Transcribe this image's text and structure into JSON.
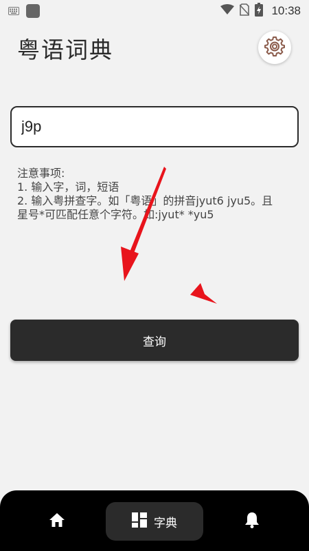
{
  "status_bar": {
    "time": "10:38",
    "icons": [
      "keyboard-icon",
      "app-icon",
      "wifi-icon",
      "no-sim-icon",
      "battery-charging-icon"
    ]
  },
  "header": {
    "title": "粤语词典",
    "settings_icon": "gear-icon"
  },
  "search": {
    "value": "j9p"
  },
  "notes": {
    "heading": "注意事项:",
    "line1": "1. 输入字，词，短语",
    "line2": "2. 输入粤拼查字。如「粤语」的拼音jyut6  jyu5。且",
    "line3": "星号*可匹配任意个字符。如:jyut*  *yu5"
  },
  "query_button": {
    "label": "查询"
  },
  "annotation": {
    "color": "#e8141c"
  },
  "bottom_nav": {
    "items": [
      {
        "icon": "home-icon",
        "label": ""
      },
      {
        "icon": "dictionary-grid-icon",
        "label": "字典",
        "active": true
      },
      {
        "icon": "bell-icon",
        "label": ""
      }
    ]
  }
}
